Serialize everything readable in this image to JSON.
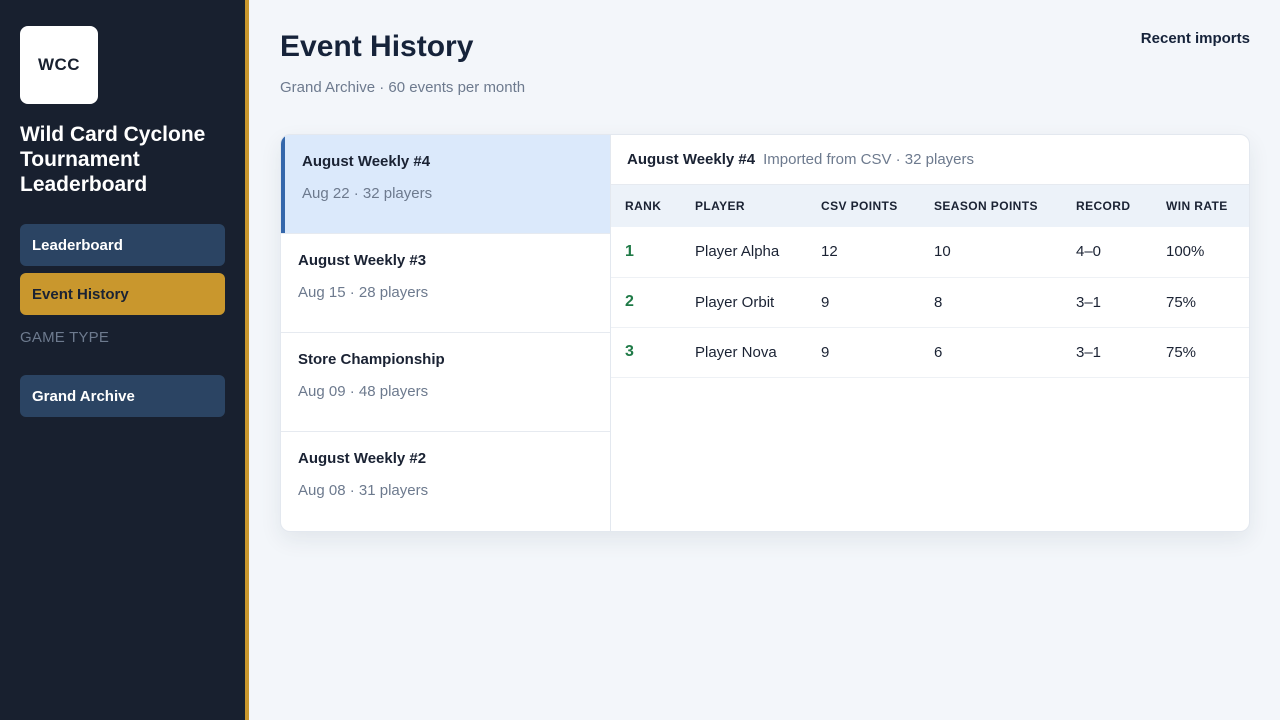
{
  "app": {
    "logo_text": "WCC",
    "title": "Wild Card Cyclone Tournament Leaderboard"
  },
  "sidebar": {
    "nav": [
      {
        "label": "Leaderboard",
        "active": false
      },
      {
        "label": "Event History",
        "active": true
      }
    ],
    "section_label": "GAME TYPE",
    "game_types": [
      {
        "label": "Grand Archive"
      }
    ]
  },
  "header": {
    "title": "Event History",
    "subtitle": "Grand Archive · 60 events per month",
    "recent_imports": "Recent imports"
  },
  "events": [
    {
      "name": "August Weekly #4",
      "meta": "Aug 22 · 32 players",
      "active": true
    },
    {
      "name": "August Weekly #3",
      "meta": "Aug 15 · 28 players",
      "active": false
    },
    {
      "name": "Store Championship",
      "meta": "Aug 09 · 48 players",
      "active": false
    },
    {
      "name": "August Weekly #2",
      "meta": "Aug 08 · 31 players",
      "active": false
    }
  ],
  "detail": {
    "title": "August Weekly #4",
    "meta": "Imported from CSV · 32 players",
    "columns": [
      "RANK",
      "PLAYER",
      "CSV POINTS",
      "SEASON POINTS",
      "RECORD",
      "WIN RATE"
    ],
    "rows": [
      {
        "rank": "1",
        "player": "Player Alpha",
        "csv_points": "12",
        "season_points": "10",
        "record": "4–0",
        "win_rate": "100%"
      },
      {
        "rank": "2",
        "player": "Player Orbit",
        "csv_points": "9",
        "season_points": "8",
        "record": "3–1",
        "win_rate": "75%"
      },
      {
        "rank": "3",
        "player": "Player Nova",
        "csv_points": "9",
        "season_points": "6",
        "record": "3–1",
        "win_rate": "75%"
      }
    ]
  },
  "colors": {
    "sidebar_bg": "#18202f",
    "accent_gold": "#c9972d",
    "nav_blue": "#2b4463",
    "active_event_bg": "#dbe9fb",
    "active_event_bar": "#3467ab",
    "rank_green": "#1f7a47"
  }
}
